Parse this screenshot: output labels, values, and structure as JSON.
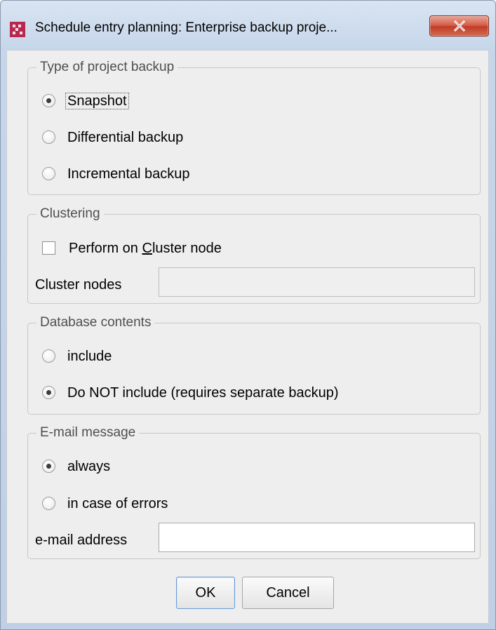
{
  "window": {
    "title": "Schedule entry planning: Enterprise backup proje...",
    "close_symbol": "X"
  },
  "backup_type": {
    "legend": "Type of project backup",
    "options": [
      {
        "label": "Snapshot",
        "checked": true
      },
      {
        "label": "Differential backup",
        "checked": false
      },
      {
        "label": "Incremental backup",
        "checked": false
      }
    ]
  },
  "clustering": {
    "legend": "Clustering",
    "checkbox_prefix": "Perform on ",
    "checkbox_mnemonic": "C",
    "checkbox_suffix": "luster node",
    "checkbox_checked": false,
    "nodes_label": "Cluster nodes",
    "nodes_value": ""
  },
  "database": {
    "legend": "Database contents",
    "options": [
      {
        "label": "include",
        "checked": false
      },
      {
        "label": "Do NOT include (requires separate backup)",
        "checked": true
      }
    ]
  },
  "email": {
    "legend": "E-mail message",
    "options": [
      {
        "label": "always",
        "checked": true
      },
      {
        "label": "in case of errors",
        "checked": false
      }
    ],
    "address_label": "e-mail address",
    "address_value": ""
  },
  "buttons": {
    "ok": "OK",
    "cancel": "Cancel"
  },
  "icons": {
    "app": "app-logo-icon",
    "close": "close-icon"
  },
  "colors": {
    "title_gradient": "#c6d6ea",
    "close_button": "#c23c27",
    "app_icon": "#b8274f",
    "client_bg": "#eeeeee"
  }
}
